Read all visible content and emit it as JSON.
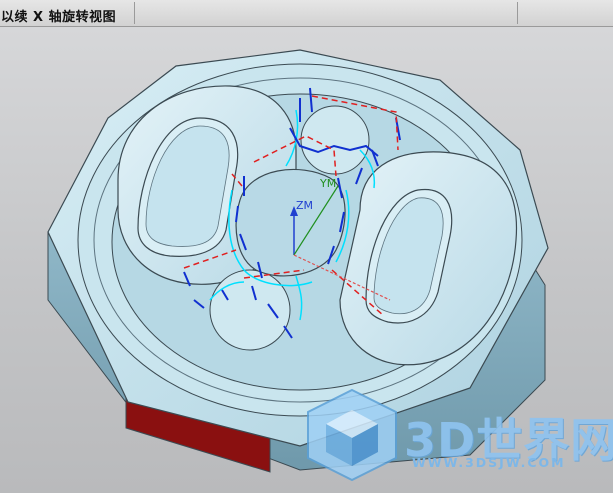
{
  "window": {
    "title": "以续 X 轴旋转视图"
  },
  "viewport": {
    "axis_labels": {
      "zm": "ZM",
      "ym": "YM"
    },
    "colors": {
      "part_face": "#c2e0ea",
      "part_edge": "#3b4a52",
      "side_band": "#8a1010",
      "toolpath_rapid": "#e02020",
      "toolpath_cut": "#1030d0",
      "toolpath_fine": "#00e0ff",
      "axis_z": "#2040d0",
      "axis_y": "#209020",
      "axis_x": "#e05050"
    }
  },
  "watermark": {
    "brand": "3D世界网",
    "url": "WWW.3DSJW.COM",
    "logo_icon": "cube-logo-icon"
  }
}
